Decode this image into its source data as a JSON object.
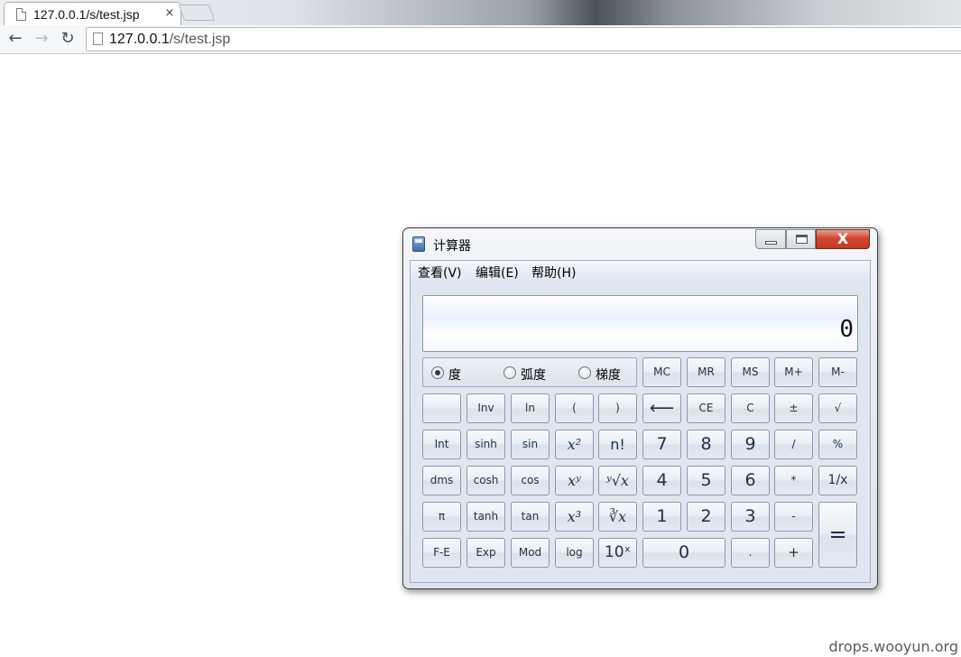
{
  "browser": {
    "tab_title": "127.0.0.1/s/test.jsp",
    "tab_close": "×",
    "url_host": "127.0.0.1",
    "url_path": "/s/test.jsp",
    "back": "←",
    "forward": "→",
    "reload": "↻"
  },
  "calculator": {
    "title": "计算器",
    "close_glyph": "X",
    "menu": [
      "查看(V)",
      "编辑(E)",
      "帮助(H)"
    ],
    "display_value": "0",
    "angle_units": [
      {
        "label": "度",
        "checked": true
      },
      {
        "label": "弧度",
        "checked": false
      },
      {
        "label": "梯度",
        "checked": false
      }
    ],
    "memory_row": [
      "MC",
      "MR",
      "MS",
      "M+",
      "M-"
    ],
    "rows": [
      [
        "",
        "Inv",
        "ln",
        "(",
        ")",
        "⟵",
        "CE",
        "C",
        "±",
        "√"
      ],
      [
        "Int",
        "sinh",
        "sin",
        "x²",
        "n!",
        "7",
        "8",
        "9",
        "/",
        "%"
      ],
      [
        "dms",
        "cosh",
        "cos",
        "xʸ",
        "ʸ√x",
        "4",
        "5",
        "6",
        "*",
        "1/x"
      ],
      [
        "π",
        "tanh",
        "tan",
        "x³",
        "∛x",
        "1",
        "2",
        "3",
        "-",
        "="
      ],
      [
        "F-E",
        "Exp",
        "Mod",
        "log",
        "10ˣ",
        "0",
        ".",
        "+"
      ]
    ]
  },
  "watermark": "drops.wooyun.org"
}
